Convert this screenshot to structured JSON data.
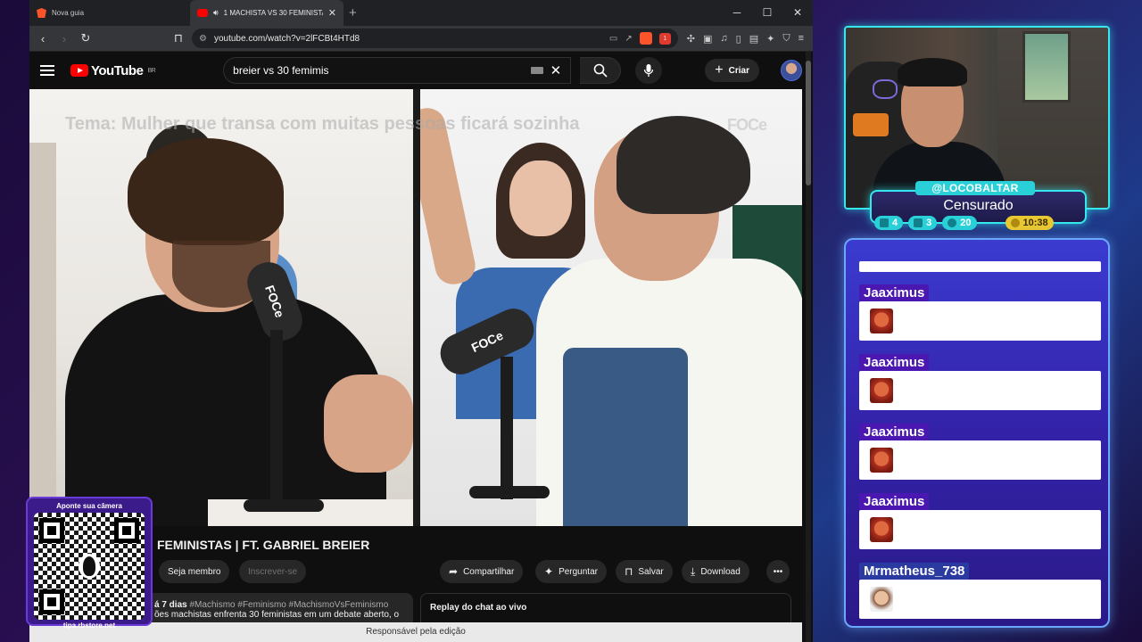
{
  "browser": {
    "tabs": [
      {
        "label": "Nova guia",
        "icon": "brave-icon"
      },
      {
        "label": "1 MACHISTA VS 30 FEMINISTAS | FT...",
        "icon": "youtube-icon"
      }
    ],
    "new_tab": "+",
    "url": "youtube.com/watch?v=2lFCBt4HTd8",
    "brave_badge": "1"
  },
  "youtube": {
    "region": "BR",
    "logo": "YouTube",
    "search_query": "breier vs 30 femimis",
    "create_label": "Criar"
  },
  "video": {
    "topic": "Tema: Mulher que transa com muitas pessoas ficará sozinha",
    "watermark": "FOCe",
    "mic_brand": "FOCe",
    "title": "FEMINISTAS | FT. GABRIEL BREIER",
    "join_label": "Seja membro",
    "subscribe_label": "Inscrever-se",
    "share_label": "Compartilhar",
    "ask_label": "Perguntar",
    "save_label": "Salvar",
    "download_label": "Download",
    "desc_meta": "á 7 dias",
    "desc_tags": "#Machismo #Feminismo #MachismoVsFeminismo",
    "desc_line2": "ões machistas enfrenta 30 feministas em um debate aberto, o",
    "chat_replay": "Replay do chat ao vivo",
    "download_bar": "Responsável pela edição"
  },
  "qr": {
    "caption": "Aponte sua câmera",
    "site": "tipa.rbstore.net"
  },
  "stream": {
    "handle": "@LOCOBALTAR",
    "game": "Censurado",
    "stats": {
      "chat": "4",
      "youtube": "3",
      "whatsapp": "20",
      "time": "10:38"
    }
  },
  "chat": {
    "messages": [
      {
        "user": "Jaaximus",
        "emote": "angry-emote"
      },
      {
        "user": "Jaaximus",
        "emote": "angry-emote"
      },
      {
        "user": "Jaaximus",
        "emote": "angry-emote"
      },
      {
        "user": "Jaaximus",
        "emote": "angry-emote"
      },
      {
        "user": "Mrmatheus_738",
        "emote": "face-emote"
      }
    ]
  }
}
